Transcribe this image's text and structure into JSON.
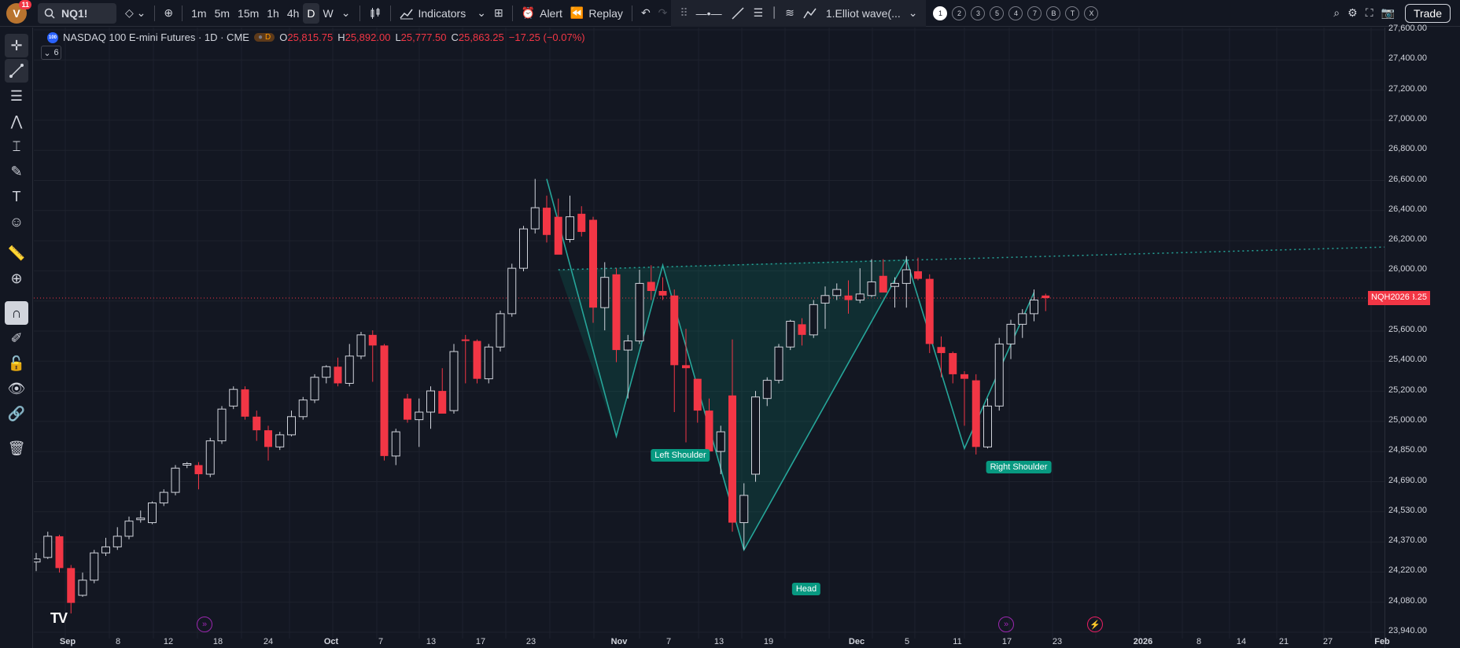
{
  "toolbar": {
    "avatar_letter": "V",
    "notifications": "11",
    "symbol": "NQ1!",
    "timeframes": [
      "1m",
      "5m",
      "15m",
      "1h",
      "4h",
      "D",
      "W"
    ],
    "active_timeframe": "D",
    "indicators_label": "Indicators",
    "alert_label": "Alert",
    "replay_label": "Replay",
    "drawing_name": "1.Elliot wave(...",
    "wave_numbers": [
      "1",
      "2",
      "3",
      "5",
      "4",
      "7",
      "B",
      "T",
      "X"
    ],
    "trade_label": "Trade"
  },
  "legend": {
    "title": "NASDAQ 100 E-mini Futures · 1D · CME",
    "symbol_icon": "100",
    "badge": "D",
    "open_k": "O",
    "open_v": "25,815.75",
    "high_k": "H",
    "high_v": "25,892.00",
    "low_k": "L",
    "low_v": "25,777.50",
    "close_k": "C",
    "close_v": "25,863.25",
    "change": "−17.25 (−0.07%)",
    "collapse_count": "6"
  },
  "price_axis": {
    "labels": [
      "27,600.00",
      "27,400.00",
      "27,200.00",
      "27,000.00",
      "26,800.00",
      "26,600.00",
      "26,400.00",
      "26,200.00",
      "26,000.00",
      "25,800.00",
      "25,600.00",
      "25,400.00",
      "25,200.00",
      "25,000.00",
      "24,850.00",
      "24,690.00",
      "24,530.00",
      "24,370.00",
      "24,220.00",
      "24,080.00",
      "23,940.00"
    ],
    "last_price": "25,863.25",
    "contract": "NQH2026"
  },
  "time_axis": {
    "labels": [
      "Sep",
      "8",
      "12",
      "18",
      "24",
      "Oct",
      "7",
      "13",
      "17",
      "23",
      "Nov",
      "7",
      "13",
      "19",
      "Dec",
      "5",
      "11",
      "17",
      "23",
      "2026",
      "8",
      "14",
      "21",
      "27",
      "Feb"
    ],
    "bold_labels": [
      "Sep",
      "Oct",
      "Nov",
      "Dec",
      "2026",
      "Feb"
    ]
  },
  "pattern_labels": {
    "left_shoulder": "Left Shoulder",
    "head": "Head",
    "right_shoulder": "Right Shoulder"
  },
  "colors": {
    "up": "#089981",
    "down": "#f23645",
    "pattern": "#089981"
  },
  "chart_data": {
    "type": "candlestick",
    "title": "NASDAQ 100 E-mini Futures · 1D · CME",
    "yrange": [
      23900,
      27650
    ],
    "candles": [
      {
        "o": 24120,
        "h": 24180,
        "l": 24060,
        "c": 24140
      },
      {
        "o": 24150,
        "h": 24320,
        "l": 24140,
        "c": 24290
      },
      {
        "o": 24290,
        "h": 24300,
        "l": 24050,
        "c": 24080
      },
      {
        "o": 24080,
        "h": 24100,
        "l": 23780,
        "c": 23850
      },
      {
        "o": 23900,
        "h": 24050,
        "l": 23890,
        "c": 24000
      },
      {
        "o": 24000,
        "h": 24200,
        "l": 23980,
        "c": 24180
      },
      {
        "o": 24180,
        "h": 24280,
        "l": 24160,
        "c": 24220
      },
      {
        "o": 24220,
        "h": 24350,
        "l": 24200,
        "c": 24290
      },
      {
        "o": 24290,
        "h": 24420,
        "l": 24270,
        "c": 24390
      },
      {
        "o": 24400,
        "h": 24460,
        "l": 24380,
        "c": 24410
      },
      {
        "o": 24380,
        "h": 24520,
        "l": 24370,
        "c": 24510
      },
      {
        "o": 24510,
        "h": 24600,
        "l": 24490,
        "c": 24580
      },
      {
        "o": 24580,
        "h": 24760,
        "l": 24560,
        "c": 24740
      },
      {
        "o": 24760,
        "h": 24780,
        "l": 24740,
        "c": 24770
      },
      {
        "o": 24760,
        "h": 24780,
        "l": 24600,
        "c": 24700
      },
      {
        "o": 24700,
        "h": 24940,
        "l": 24680,
        "c": 24920
      },
      {
        "o": 24920,
        "h": 25150,
        "l": 24900,
        "c": 25130
      },
      {
        "o": 25150,
        "h": 25280,
        "l": 25130,
        "c": 25260
      },
      {
        "o": 25260,
        "h": 25280,
        "l": 25060,
        "c": 25080
      },
      {
        "o": 25080,
        "h": 25120,
        "l": 24920,
        "c": 24990
      },
      {
        "o": 24990,
        "h": 25020,
        "l": 24790,
        "c": 24880
      },
      {
        "o": 24880,
        "h": 24980,
        "l": 24860,
        "c": 24960
      },
      {
        "o": 24960,
        "h": 25120,
        "l": 24950,
        "c": 25080
      },
      {
        "o": 25080,
        "h": 25210,
        "l": 25060,
        "c": 25190
      },
      {
        "o": 25190,
        "h": 25360,
        "l": 25170,
        "c": 25340
      },
      {
        "o": 25340,
        "h": 25420,
        "l": 25300,
        "c": 25410
      },
      {
        "o": 25410,
        "h": 25470,
        "l": 25280,
        "c": 25300
      },
      {
        "o": 25300,
        "h": 25560,
        "l": 25280,
        "c": 25480
      },
      {
        "o": 25480,
        "h": 25640,
        "l": 25460,
        "c": 25620
      },
      {
        "o": 25620,
        "h": 25650,
        "l": 25310,
        "c": 25550
      },
      {
        "o": 25550,
        "h": 25560,
        "l": 24790,
        "c": 24820
      },
      {
        "o": 24820,
        "h": 25000,
        "l": 24760,
        "c": 24980
      },
      {
        "o": 25200,
        "h": 25230,
        "l": 25040,
        "c": 25060
      },
      {
        "o": 25060,
        "h": 25200,
        "l": 24880,
        "c": 25110
      },
      {
        "o": 25110,
        "h": 25280,
        "l": 25000,
        "c": 25250
      },
      {
        "o": 25250,
        "h": 25400,
        "l": 25150,
        "c": 25100
      },
      {
        "o": 25120,
        "h": 25560,
        "l": 25100,
        "c": 25510
      },
      {
        "o": 25590,
        "h": 25620,
        "l": 25300,
        "c": 25580
      },
      {
        "o": 25580,
        "h": 25590,
        "l": 25300,
        "c": 25330
      },
      {
        "o": 25330,
        "h": 25560,
        "l": 25300,
        "c": 25540
      },
      {
        "o": 25540,
        "h": 25780,
        "l": 25510,
        "c": 25760
      },
      {
        "o": 25760,
        "h": 26090,
        "l": 25740,
        "c": 26060
      },
      {
        "o": 26060,
        "h": 26340,
        "l": 26040,
        "c": 26320
      },
      {
        "o": 26320,
        "h": 26650,
        "l": 26290,
        "c": 26460
      },
      {
        "o": 26460,
        "h": 26540,
        "l": 26230,
        "c": 26280
      },
      {
        "o": 26400,
        "h": 26520,
        "l": 26160,
        "c": 26150
      },
      {
        "o": 26250,
        "h": 26540,
        "l": 26230,
        "c": 26400
      },
      {
        "o": 26420,
        "h": 26470,
        "l": 26270,
        "c": 26300
      },
      {
        "o": 26380,
        "h": 26400,
        "l": 25700,
        "c": 25800
      },
      {
        "o": 25800,
        "h": 26100,
        "l": 25650,
        "c": 26000
      },
      {
        "o": 26020,
        "h": 26060,
        "l": 25440,
        "c": 25520
      },
      {
        "o": 25520,
        "h": 25620,
        "l": 25200,
        "c": 25580
      },
      {
        "o": 25580,
        "h": 26050,
        "l": 25560,
        "c": 25960
      },
      {
        "o": 25970,
        "h": 26080,
        "l": 25850,
        "c": 25910
      },
      {
        "o": 25910,
        "h": 26000,
        "l": 25850,
        "c": 25880
      },
      {
        "o": 25880,
        "h": 25920,
        "l": 25110,
        "c": 25420
      },
      {
        "o": 25420,
        "h": 25660,
        "l": 24910,
        "c": 25400
      },
      {
        "o": 25330,
        "h": 25330,
        "l": 25040,
        "c": 25120
      },
      {
        "o": 25120,
        "h": 25200,
        "l": 24800,
        "c": 24850
      },
      {
        "o": 24850,
        "h": 25020,
        "l": 24700,
        "c": 24980
      },
      {
        "o": 25220,
        "h": 25590,
        "l": 24320,
        "c": 24380
      },
      {
        "o": 24380,
        "h": 24640,
        "l": 24200,
        "c": 24560
      },
      {
        "o": 24700,
        "h": 25250,
        "l": 24650,
        "c": 25210
      },
      {
        "o": 25200,
        "h": 25340,
        "l": 25150,
        "c": 25320
      },
      {
        "o": 25320,
        "h": 25560,
        "l": 25300,
        "c": 25540
      },
      {
        "o": 25540,
        "h": 25720,
        "l": 25520,
        "c": 25710
      },
      {
        "o": 25690,
        "h": 25730,
        "l": 25550,
        "c": 25620
      },
      {
        "o": 25620,
        "h": 25850,
        "l": 25600,
        "c": 25820
      },
      {
        "o": 25830,
        "h": 25940,
        "l": 25660,
        "c": 25880
      },
      {
        "o": 25880,
        "h": 25960,
        "l": 25850,
        "c": 25920
      },
      {
        "o": 25880,
        "h": 25980,
        "l": 25760,
        "c": 25850
      },
      {
        "o": 25850,
        "h": 26060,
        "l": 25830,
        "c": 25890
      },
      {
        "o": 25880,
        "h": 26120,
        "l": 25870,
        "c": 25970
      },
      {
        "o": 26010,
        "h": 26120,
        "l": 25920,
        "c": 25900
      },
      {
        "o": 25940,
        "h": 26000,
        "l": 25800,
        "c": 25960
      },
      {
        "o": 25960,
        "h": 26140,
        "l": 25800,
        "c": 26050
      },
      {
        "o": 26040,
        "h": 26130,
        "l": 25980,
        "c": 25990
      },
      {
        "o": 25990,
        "h": 26020,
        "l": 25500,
        "c": 25560
      },
      {
        "o": 25540,
        "h": 25610,
        "l": 25340,
        "c": 25500
      },
      {
        "o": 25500,
        "h": 25510,
        "l": 25300,
        "c": 25360
      },
      {
        "o": 25360,
        "h": 25380,
        "l": 25020,
        "c": 25330
      },
      {
        "o": 25320,
        "h": 25360,
        "l": 24830,
        "c": 24880
      },
      {
        "o": 24880,
        "h": 25200,
        "l": 24870,
        "c": 25150
      },
      {
        "o": 25150,
        "h": 25600,
        "l": 25120,
        "c": 25560
      },
      {
        "o": 25560,
        "h": 25720,
        "l": 25460,
        "c": 25690
      },
      {
        "o": 25690,
        "h": 25790,
        "l": 25600,
        "c": 25760
      },
      {
        "o": 25760,
        "h": 25920,
        "l": 25710,
        "c": 25850
      },
      {
        "o": 25880,
        "h": 25892,
        "l": 25777,
        "c": 25863
      }
    ],
    "pattern": {
      "name": "Head and Shoulders (inverse)",
      "points": [
        {
          "candle": 44,
          "price": 26650
        },
        {
          "candle": 50,
          "price": 24950
        },
        {
          "candle": 54,
          "price": 26080
        },
        {
          "candle": 61,
          "price": 24200
        },
        {
          "candle": 75,
          "price": 26120
        },
        {
          "candle": 80,
          "price": 24870
        },
        {
          "candle": 86,
          "price": 25900
        }
      ]
    }
  }
}
